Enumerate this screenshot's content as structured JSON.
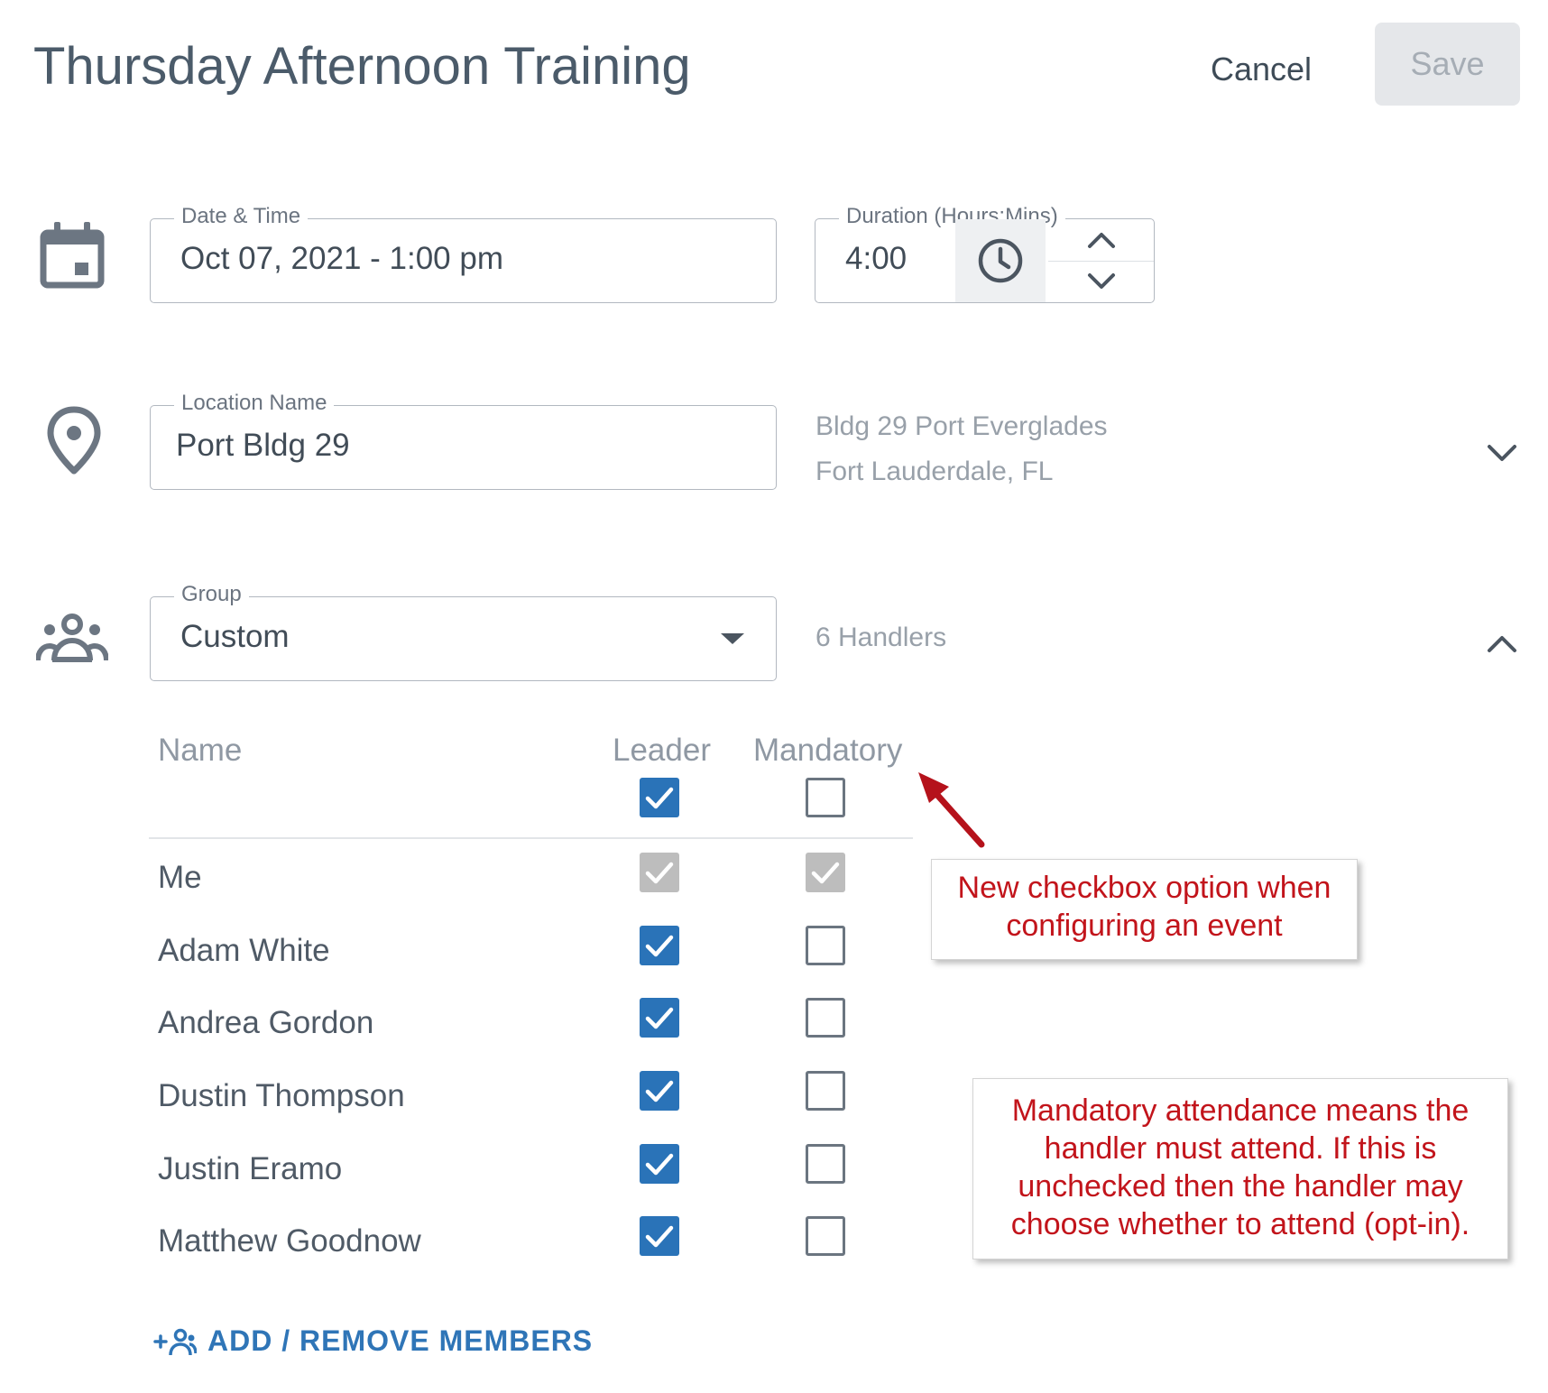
{
  "header": {
    "title": "Thursday Afternoon Training",
    "cancel_label": "Cancel",
    "save_label": "Save"
  },
  "datetime": {
    "icon": "calendar-icon",
    "label": "Date & Time",
    "value": "Oct 07, 2021 - 1:00 pm"
  },
  "duration": {
    "label": "Duration (Hours:Mins)",
    "value": "4:00",
    "icons": [
      "clock-icon",
      "chevron-up-icon",
      "chevron-down-icon"
    ]
  },
  "location": {
    "icon": "location-pin-icon",
    "label": "Location Name",
    "value": "Port Bldg 29",
    "address_line1": "Bldg 29 Port Everglades",
    "address_line2": "Fort Lauderdale, FL",
    "expand_icon": "chevron-down-icon"
  },
  "group": {
    "icon": "group-icon",
    "label": "Group",
    "value": "Custom",
    "dropdown_icon": "caret-down-icon",
    "count_text": "6 Handlers",
    "collapse_icon": "chevron-up-icon"
  },
  "table": {
    "headers": {
      "name": "Name",
      "leader": "Leader",
      "mandatory": "Mandatory"
    },
    "header_checkboxes": {
      "leader": "checked",
      "mandatory": "unchecked"
    },
    "rows": [
      {
        "name": "Me",
        "leader": "disabled-checked",
        "mandatory": "disabled-checked"
      },
      {
        "name": "Adam White",
        "leader": "checked",
        "mandatory": "unchecked"
      },
      {
        "name": "Andrea Gordon",
        "leader": "checked",
        "mandatory": "unchecked"
      },
      {
        "name": "Dustin Thompson",
        "leader": "checked",
        "mandatory": "unchecked"
      },
      {
        "name": "Justin Eramo",
        "leader": "checked",
        "mandatory": "unchecked"
      },
      {
        "name": "Matthew Goodnow",
        "leader": "checked",
        "mandatory": "unchecked"
      }
    ]
  },
  "add_members": {
    "icon": "add-group-icon",
    "label": "ADD / REMOVE MEMBERS"
  },
  "annotations": {
    "callout1": {
      "line1": "New checkbox option when",
      "line2": "configuring an event"
    },
    "callout2": {
      "line1": "Mandatory attendance means the",
      "line2": "handler must attend. If this is",
      "line3": "unchecked then the handler may",
      "line4": "choose whether to attend (opt-in)."
    },
    "arrow_icon": "red-arrow-icon"
  },
  "colors": {
    "accent": "#2a73b8",
    "annotation": "#c2141b",
    "text": "#4b5b6a",
    "muted": "#98a0a9",
    "disabled_checkbox": "#bdbdbd"
  }
}
